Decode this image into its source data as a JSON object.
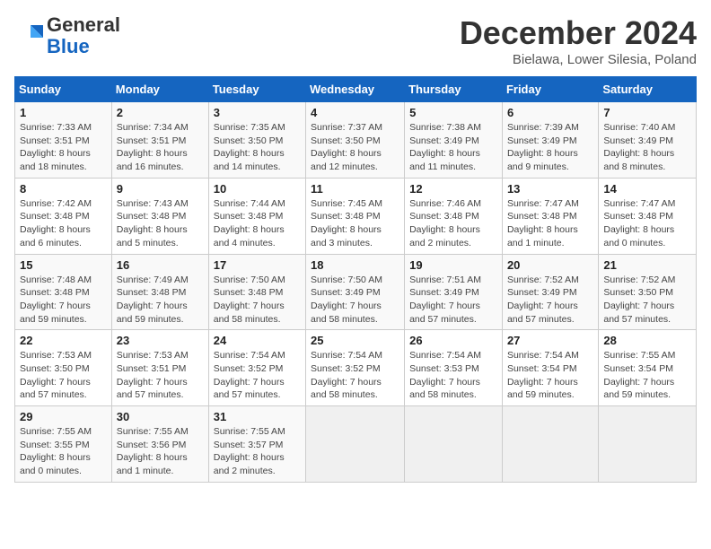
{
  "header": {
    "logo_line1": "General",
    "logo_line2": "Blue",
    "month": "December 2024",
    "location": "Bielawa, Lower Silesia, Poland"
  },
  "days_of_week": [
    "Sunday",
    "Monday",
    "Tuesday",
    "Wednesday",
    "Thursday",
    "Friday",
    "Saturday"
  ],
  "weeks": [
    [
      {
        "day": "1",
        "sunrise": "7:33 AM",
        "sunset": "3:51 PM",
        "daylight": "8 hours and 18 minutes."
      },
      {
        "day": "2",
        "sunrise": "7:34 AM",
        "sunset": "3:51 PM",
        "daylight": "8 hours and 16 minutes."
      },
      {
        "day": "3",
        "sunrise": "7:35 AM",
        "sunset": "3:50 PM",
        "daylight": "8 hours and 14 minutes."
      },
      {
        "day": "4",
        "sunrise": "7:37 AM",
        "sunset": "3:50 PM",
        "daylight": "8 hours and 12 minutes."
      },
      {
        "day": "5",
        "sunrise": "7:38 AM",
        "sunset": "3:49 PM",
        "daylight": "8 hours and 11 minutes."
      },
      {
        "day": "6",
        "sunrise": "7:39 AM",
        "sunset": "3:49 PM",
        "daylight": "8 hours and 9 minutes."
      },
      {
        "day": "7",
        "sunrise": "7:40 AM",
        "sunset": "3:49 PM",
        "daylight": "8 hours and 8 minutes."
      }
    ],
    [
      {
        "day": "8",
        "sunrise": "7:42 AM",
        "sunset": "3:48 PM",
        "daylight": "8 hours and 6 minutes."
      },
      {
        "day": "9",
        "sunrise": "7:43 AM",
        "sunset": "3:48 PM",
        "daylight": "8 hours and 5 minutes."
      },
      {
        "day": "10",
        "sunrise": "7:44 AM",
        "sunset": "3:48 PM",
        "daylight": "8 hours and 4 minutes."
      },
      {
        "day": "11",
        "sunrise": "7:45 AM",
        "sunset": "3:48 PM",
        "daylight": "8 hours and 3 minutes."
      },
      {
        "day": "12",
        "sunrise": "7:46 AM",
        "sunset": "3:48 PM",
        "daylight": "8 hours and 2 minutes."
      },
      {
        "day": "13",
        "sunrise": "7:47 AM",
        "sunset": "3:48 PM",
        "daylight": "8 hours and 1 minute."
      },
      {
        "day": "14",
        "sunrise": "7:47 AM",
        "sunset": "3:48 PM",
        "daylight": "8 hours and 0 minutes."
      }
    ],
    [
      {
        "day": "15",
        "sunrise": "7:48 AM",
        "sunset": "3:48 PM",
        "daylight": "7 hours and 59 minutes."
      },
      {
        "day": "16",
        "sunrise": "7:49 AM",
        "sunset": "3:48 PM",
        "daylight": "7 hours and 59 minutes."
      },
      {
        "day": "17",
        "sunrise": "7:50 AM",
        "sunset": "3:48 PM",
        "daylight": "7 hours and 58 minutes."
      },
      {
        "day": "18",
        "sunrise": "7:50 AM",
        "sunset": "3:49 PM",
        "daylight": "7 hours and 58 minutes."
      },
      {
        "day": "19",
        "sunrise": "7:51 AM",
        "sunset": "3:49 PM",
        "daylight": "7 hours and 57 minutes."
      },
      {
        "day": "20",
        "sunrise": "7:52 AM",
        "sunset": "3:49 PM",
        "daylight": "7 hours and 57 minutes."
      },
      {
        "day": "21",
        "sunrise": "7:52 AM",
        "sunset": "3:50 PM",
        "daylight": "7 hours and 57 minutes."
      }
    ],
    [
      {
        "day": "22",
        "sunrise": "7:53 AM",
        "sunset": "3:50 PM",
        "daylight": "7 hours and 57 minutes."
      },
      {
        "day": "23",
        "sunrise": "7:53 AM",
        "sunset": "3:51 PM",
        "daylight": "7 hours and 57 minutes."
      },
      {
        "day": "24",
        "sunrise": "7:54 AM",
        "sunset": "3:52 PM",
        "daylight": "7 hours and 57 minutes."
      },
      {
        "day": "25",
        "sunrise": "7:54 AM",
        "sunset": "3:52 PM",
        "daylight": "7 hours and 58 minutes."
      },
      {
        "day": "26",
        "sunrise": "7:54 AM",
        "sunset": "3:53 PM",
        "daylight": "7 hours and 58 minutes."
      },
      {
        "day": "27",
        "sunrise": "7:54 AM",
        "sunset": "3:54 PM",
        "daylight": "7 hours and 59 minutes."
      },
      {
        "day": "28",
        "sunrise": "7:55 AM",
        "sunset": "3:54 PM",
        "daylight": "7 hours and 59 minutes."
      }
    ],
    [
      {
        "day": "29",
        "sunrise": "7:55 AM",
        "sunset": "3:55 PM",
        "daylight": "8 hours and 0 minutes."
      },
      {
        "day": "30",
        "sunrise": "7:55 AM",
        "sunset": "3:56 PM",
        "daylight": "8 hours and 1 minute."
      },
      {
        "day": "31",
        "sunrise": "7:55 AM",
        "sunset": "3:57 PM",
        "daylight": "8 hours and 2 minutes."
      },
      null,
      null,
      null,
      null
    ]
  ]
}
